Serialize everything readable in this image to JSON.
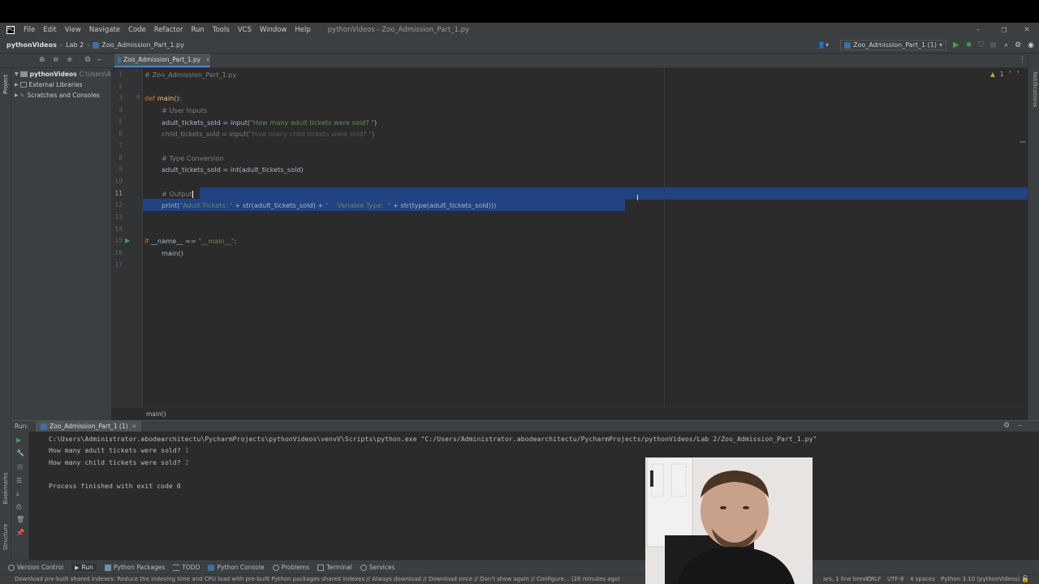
{
  "menu": [
    "File",
    "Edit",
    "View",
    "Navigate",
    "Code",
    "Refactor",
    "Run",
    "Tools",
    "VCS",
    "Window",
    "Help"
  ],
  "window_title": "pythonVideos - Zoo_Admission_Part_1.py",
  "nav": {
    "project": "pythonVideos",
    "folder": "Lab 2",
    "file": "Zoo_Admission_Part_1.py",
    "run_config": "Zoo_Admission_Part_1 (1)"
  },
  "tab": {
    "label": "Zoo_Admission_Part_1.py"
  },
  "project_panel": {
    "root": "pythonVideos",
    "root_path": "C:\\Users\\A",
    "items": [
      "External Libraries",
      "Scratches and Consoles"
    ]
  },
  "editor": {
    "inspection": "1",
    "lines": [
      "1",
      "2",
      "3",
      "4",
      "5",
      "6",
      "7",
      "8",
      "9",
      "10",
      "11",
      "12",
      "13",
      "14",
      "15",
      "16",
      "17"
    ],
    "code": {
      "l1": "# Zoo_Admission_Part_1.py",
      "l3_kw": "def ",
      "l3_fn": "main",
      "l3_rest": "():",
      "l4": "# User Inputs",
      "l5_a": "adult_tickets_sold = ",
      "l5_b": "input(",
      "l5_s": "\"How many adult tickets were sold? \"",
      "l5_c": ")",
      "l6_a": "child_tickets_sold = ",
      "l6_b": "input(",
      "l6_s": "\"How many child tickets were sold? \"",
      "l6_c": ")",
      "l8": "# Type Conversion",
      "l9_a": "adult_tickets_sold = ",
      "l9_b": "int(adult_tickets_sold)",
      "l11": "# Output",
      "l12_a": "print(",
      "l12_s1": "\"Adult Tickets: \"",
      "l12_b": " + str(adult_tickets_sold) + ",
      "l12_s2": "\"    Variable Type:  \"",
      "l12_c": " + str(type(adult_tickets_sold)))",
      "l15_kw": "if ",
      "l15_a": "__name__ == ",
      "l15_s": "\"__main__\"",
      "l15_c": ":",
      "l16": "main()"
    }
  },
  "breadcrumb": "main()",
  "run": {
    "title": "Run:",
    "tab": "Zoo_Admission_Part_1 (1)",
    "cmd": "C:\\Users\\Administrator.abodearchitectu\\PycharmProjects\\pythonVideos\\venvV\\Scripts\\python.exe \"C:/Users/Administrator.abodearchitectu/PycharmProjects/pythonVideos/Lab 2/Zoo_Admission_Part_1.py\"",
    "q1": "How many adult tickets were sold? ",
    "a1": "1",
    "q2": "How many child tickets were sold? ",
    "a2": "2",
    "exit": "Process finished with exit code 0"
  },
  "bottom_tabs": [
    "Version Control",
    "Run",
    "Python Packages",
    "TODO",
    "Python Console",
    "Problems",
    "Terminal",
    "Services"
  ],
  "status": {
    "message": "Download pre-built shared indexes: Reduce the indexing time and CPU load with pre-built Python packages shared indexes // Always download // Download once // Don't show again // Configure... (26 minutes ago)",
    "line_info": "ars, 1 line break)",
    "crlf": "CRLF",
    "enc": "UTF-8",
    "indent": "4 spaces",
    "interp": "Python 3.10 (pythonVideos)"
  },
  "left_tw": {
    "project": "Project",
    "bookmarks": "Bookmarks",
    "structure": "Structure"
  },
  "right_tw": {
    "notifications": "Notifications"
  },
  "colors": {
    "selection": "#214283",
    "run_green": "#499c54",
    "keyword": "#cc7832",
    "string": "#6a8759",
    "comment": "#808080"
  }
}
